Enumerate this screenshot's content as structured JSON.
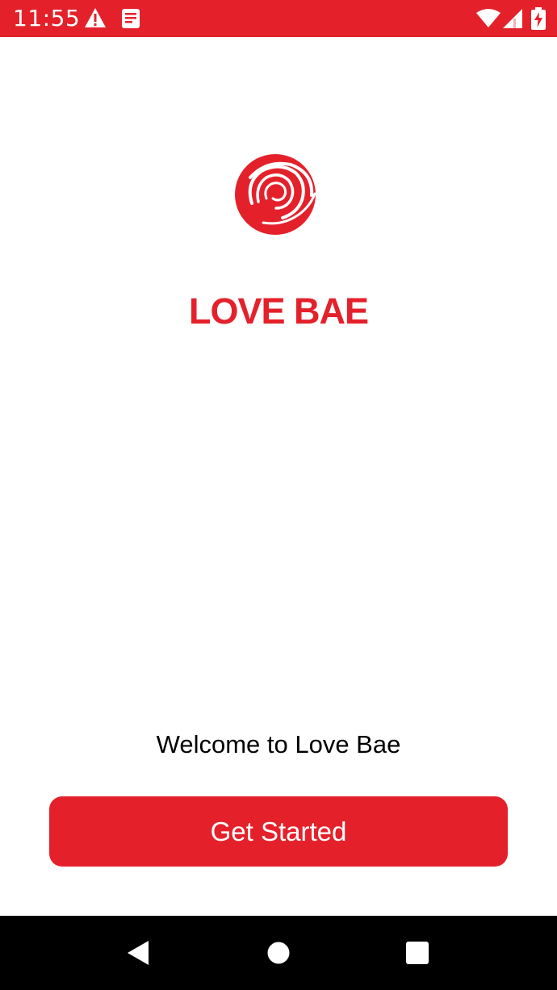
{
  "status_bar": {
    "time": "11:55",
    "background": "#e4212b",
    "icons": [
      "warning-icon",
      "notes-icon",
      "wifi-icon",
      "signal-icon",
      "battery-charging-icon"
    ]
  },
  "brand": {
    "logo": "red-spiral-logo",
    "title": "LOVE BAE",
    "color": "#e4212b"
  },
  "welcome": {
    "text": "Welcome to Love Bae"
  },
  "cta": {
    "label": "Get Started",
    "background": "#e4212b"
  },
  "nav_bar": {
    "buttons": [
      "back-icon",
      "home-icon",
      "recents-icon"
    ]
  }
}
